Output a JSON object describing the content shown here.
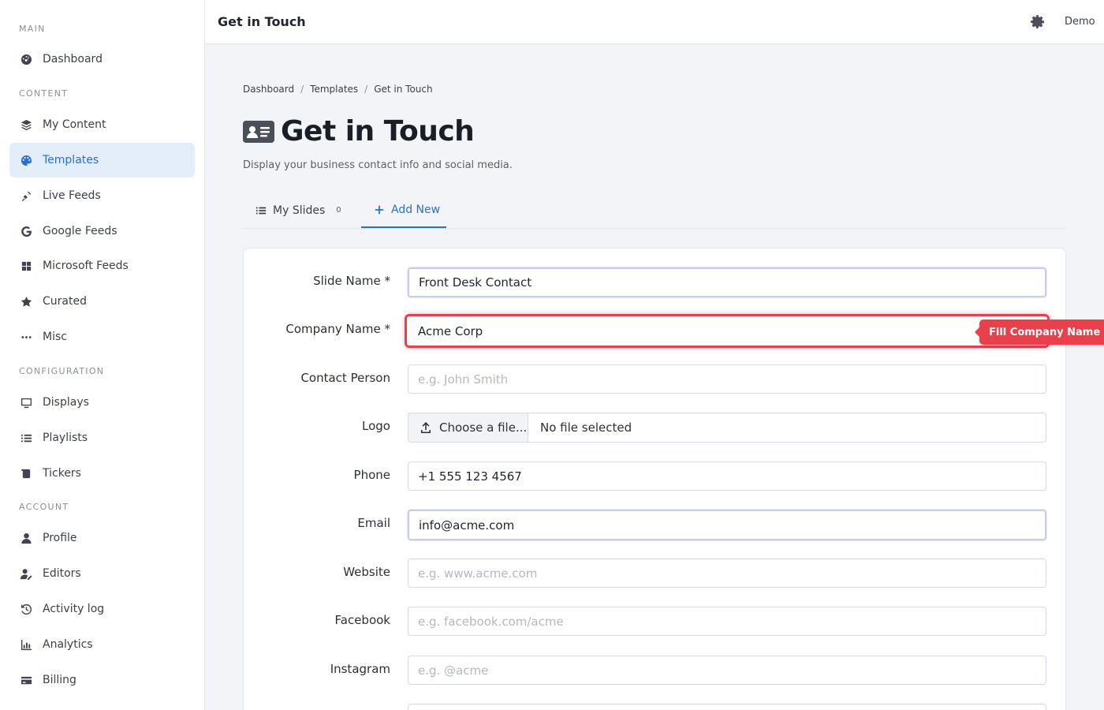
{
  "sidebar": {
    "sections": {
      "main": "MAIN",
      "content": "CONTENT",
      "configuration": "CONFIGURATION",
      "account": "ACCOUNT"
    },
    "items": [
      {
        "label": "Dashboard",
        "icon": "dashboard-icon"
      },
      {
        "label": "My Content",
        "icon": "layers-icon"
      },
      {
        "label": "Templates",
        "icon": "palette-icon",
        "active": true
      },
      {
        "label": "Live Feeds",
        "icon": "satellite-icon"
      },
      {
        "label": "Google Feeds",
        "icon": "google-icon"
      },
      {
        "label": "Microsoft Feeds",
        "icon": "windows-icon"
      },
      {
        "label": "Curated",
        "icon": "star-icon"
      },
      {
        "label": "Misc",
        "icon": "ellipsis-icon"
      },
      {
        "label": "Displays",
        "icon": "monitor-icon"
      },
      {
        "label": "Playlists",
        "icon": "list-icon"
      },
      {
        "label": "Tickers",
        "icon": "scroll-icon"
      },
      {
        "label": "Profile",
        "icon": "user-icon"
      },
      {
        "label": "Editors",
        "icon": "user-edit-icon"
      },
      {
        "label": "Activity log",
        "icon": "history-icon"
      },
      {
        "label": "Analytics",
        "icon": "chart-icon"
      },
      {
        "label": "Billing",
        "icon": "credit-card-icon"
      }
    ]
  },
  "topbar": {
    "title": "Get in Touch",
    "user": "Demo"
  },
  "breadcrumb": [
    "Dashboard",
    "Templates",
    "Get in Touch"
  ],
  "page": {
    "title": "Get in Touch",
    "subtitle": "Display your business contact info and social media."
  },
  "tabs": {
    "my_slides": "My Slides",
    "my_slides_count": "0",
    "add_new": "Add New"
  },
  "form": {
    "slide_name": {
      "label": "Slide Name *",
      "value": "Front Desk Contact"
    },
    "company_name": {
      "label": "Company Name *",
      "value": "Acme Corp"
    },
    "contact_person": {
      "label": "Contact Person",
      "placeholder": "e.g. John Smith"
    },
    "logo": {
      "label": "Logo",
      "button": "Choose a file...",
      "file": "No file selected"
    },
    "phone": {
      "label": "Phone",
      "value": "+1 555 123 4567"
    },
    "email": {
      "label": "Email",
      "value": "info@acme.com"
    },
    "website": {
      "label": "Website",
      "placeholder": "e.g. www.acme.com"
    },
    "facebook": {
      "label": "Facebook",
      "placeholder": "e.g. facebook.com/acme"
    },
    "instagram": {
      "label": "Instagram",
      "placeholder": "e.g. @acme"
    }
  },
  "tooltip": "Fill Company Name",
  "colors": {
    "accent": "#2a6fd6",
    "highlight": "#e8414b"
  }
}
